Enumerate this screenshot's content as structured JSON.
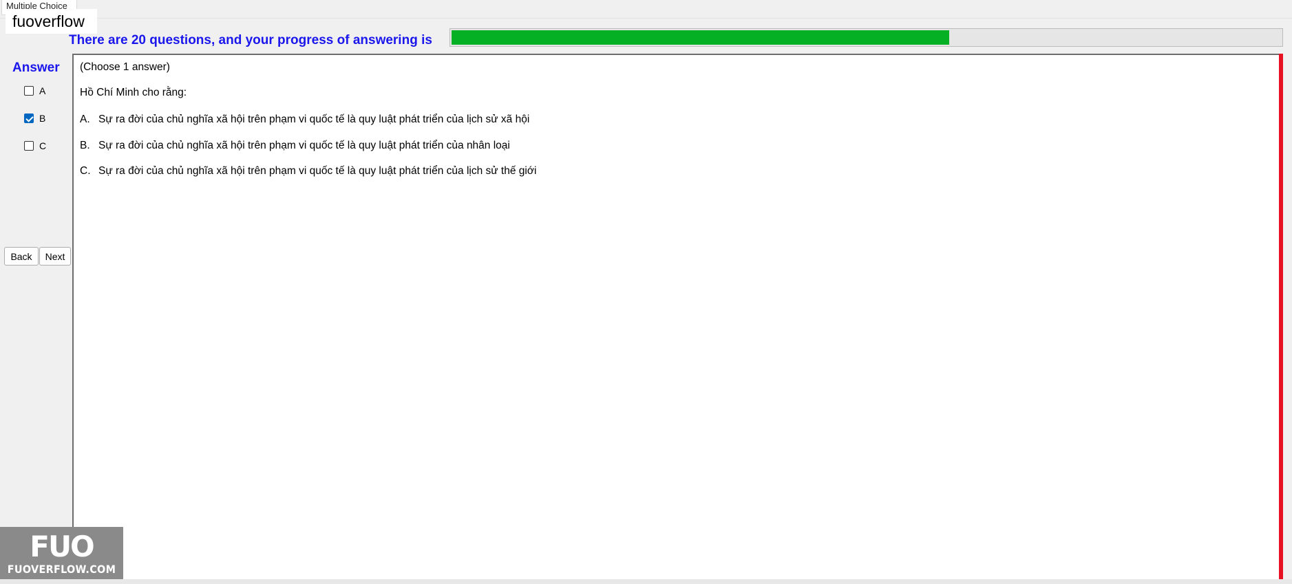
{
  "window": {
    "tab_title": "Multiple Choice"
  },
  "watermark": {
    "text": "fuoverflow"
  },
  "progress": {
    "label": "There are 20 questions, and your progress of answering is",
    "fraction": 0.6,
    "fill_color": "#06b025"
  },
  "answer_panel": {
    "title": "Answer",
    "options": [
      {
        "label": "A",
        "checked": false
      },
      {
        "label": "B",
        "checked": true
      },
      {
        "label": "C",
        "checked": false
      }
    ]
  },
  "navigation": {
    "back_label": "Back",
    "next_label": "Next"
  },
  "question": {
    "instruction": "(Choose 1 answer)",
    "stem": "Hồ Chí Minh cho rằng:",
    "choices": [
      {
        "letter": "A.",
        "text": "Sự ra đời của chủ nghĩa xã hội trên phạm vi quốc tế là quy luật phát triển của lịch sử xã hội"
      },
      {
        "letter": "B.",
        "text": "Sự ra đời của chủ nghĩa xã hội trên phạm vi quốc tế là quy luật phát triển của nhân loại"
      },
      {
        "letter": "C.",
        "text": "Sự ra đời của chủ nghĩa xã hội trên phạm vi quốc tế là quy luật phát triển của lịch sử thế giới"
      }
    ]
  },
  "logo": {
    "mark": "FUO",
    "site": "FUOVERFLOW.COM"
  },
  "colors": {
    "accent_text": "#1a16ec",
    "side_marker": "#e81123"
  }
}
